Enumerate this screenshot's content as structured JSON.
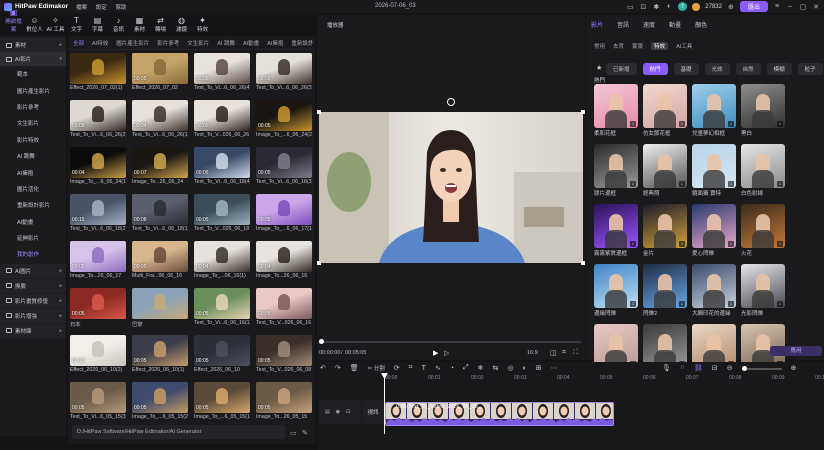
{
  "app": {
    "title": "HitPaw Edimakor",
    "menu": [
      "檔案",
      "設定",
      "幫助"
    ],
    "doc_title": "2026-07-06_03",
    "coins": "27832",
    "avatar_letter": "T",
    "export_label": "匯出"
  },
  "toolbar": [
    "開啟檔案",
    "數位人",
    "AI 工具",
    "文字",
    "字幕",
    "音訊",
    "素材",
    "轉場",
    "濾鏡",
    "特效"
  ],
  "left_nav": {
    "top": [
      "素材",
      "AI影片"
    ],
    "sub": [
      "範本",
      "圖片產生影片",
      "影片參考",
      "文生影片",
      "影片特效",
      "AI 跳舞",
      "AI擁抱",
      "圖片活化",
      "重新設計影片",
      "AI動畫",
      "延伸影片",
      "我的創作"
    ],
    "bottom": [
      "AI圖片",
      "換臉",
      "影片畫質修復",
      "影片增強",
      "素材庫"
    ]
  },
  "media_tabs": [
    "全部",
    "AI特效",
    "圖片產生影片",
    "影片參考",
    "文生影片",
    "AI 跳舞",
    "AI動畫",
    "AI擁抱",
    "重新設計"
  ],
  "media_items": [
    {
      "label": "Effect_2026_07_02(1)",
      "dur": ""
    },
    {
      "label": "Effect_2026_07_02",
      "dur": "00:05"
    },
    {
      "label": "Text_To_Vi...6_06_26(4)",
      "dur": "00:05"
    },
    {
      "label": "Text_To_Vi...6_06_26(3)",
      "dur": "00:05"
    },
    {
      "label": "Text_To_Vi...6_06_26(2)",
      "dur": "00:05"
    },
    {
      "label": "Text_To_Vi...6_06_26(1)",
      "dur": "00:04"
    },
    {
      "label": "Text_To_V...026_06_26",
      "dur": "00:05"
    },
    {
      "label": "Image_To_...6_06_24(2)",
      "dur": "00:05"
    },
    {
      "label": "Image_To_...6_06_24(1)",
      "dur": "00:04"
    },
    {
      "label": "Image_To...26_06_24",
      "dur": "00:07"
    },
    {
      "label": "Text_To_Vi...6_06_18(4)",
      "dur": "00:05"
    },
    {
      "label": "Text_To_Vi...6_06_18(3)",
      "dur": "00:05"
    },
    {
      "label": "Text_To_Vi...6_06_18(2)",
      "dur": "00:15"
    },
    {
      "label": "Text_To_Vi...6_06_18(1)",
      "dur": "00:08"
    },
    {
      "label": "Text_To_V...026_06_18",
      "dur": "00:05"
    },
    {
      "label": "Image_To_...6_06_17(1)",
      "dur": "00:05"
    },
    {
      "label": "Image_To...26_06_17",
      "dur": "00:05"
    },
    {
      "label": "Multi_Fra...06_06_16",
      "dur": "00:05"
    },
    {
      "label": "Image_To_...06_16(1)",
      "dur": "00:04"
    },
    {
      "label": "Image_To...26_06_16",
      "dur": "00:04"
    },
    {
      "label": "日本",
      "dur": "00:05"
    },
    {
      "label": "巴黎",
      "dur": ""
    },
    {
      "label": "Text_To_Vi...6_06_16(1)",
      "dur": "00:05"
    },
    {
      "label": "Text_To_V...026_06_16",
      "dur": "00:05"
    },
    {
      "label": "Effect_2026_06_10(2)",
      "dur": "00:10"
    },
    {
      "label": "Effect_2026_06_10(1)",
      "dur": "00:05"
    },
    {
      "label": "Effect_2026_06_10",
      "dur": "00:05"
    },
    {
      "label": "Text_To_V...026_06_08",
      "dur": "00:05"
    },
    {
      "label": "Text_To_Vi...6_05_15(3)",
      "dur": "00:05"
    },
    {
      "label": "Image_To_...6_05_15(2)",
      "dur": "00:05"
    },
    {
      "label": "Image_To_...6_05_15(1)",
      "dur": "00:05"
    },
    {
      "label": "Image_To...26_05_15",
      "dur": "00:05"
    }
  ],
  "path": "D:/HitPaw Software/HitPaw Edimakor/AI Generator",
  "player": {
    "title": "播放器",
    "time_current": "00:00:00",
    "time_total": "00:05:05",
    "aspect": "16:9"
  },
  "right_panel": {
    "tabs": [
      "影片",
      "音訊",
      "速度",
      "動畫",
      "顏色"
    ],
    "subtabs": [
      "常用",
      "去背",
      "蒙版",
      "特效",
      "AI工具"
    ],
    "chips": [
      "已新增",
      "熱門",
      "基礎",
      "光效",
      "自然",
      "模糊",
      "粒子"
    ],
    "section": "熱門",
    "effects": [
      "柔和花框",
      "仿女節花框",
      "兒童夢幻相框",
      "黑白",
      "膠片邊框",
      "經典照",
      "鏡面攝 寶特",
      "白色射線",
      "霧霧紫質邊框",
      "金片",
      "愛心閃爍",
      "火花",
      "邊緣閃爍",
      "閃爍2",
      "大網印花的邊緣",
      "光影閃爍",
      "",
      "",
      "",
      ""
    ],
    "apply_label": "應用"
  },
  "timeline": {
    "tools": [
      "分割"
    ],
    "ruler": [
      "00:00",
      "00:01",
      "00:02",
      "00:03",
      "00:04",
      "00:05",
      "00:06",
      "00:07",
      "00:08",
      "00:09",
      "00:10"
    ],
    "track_name": "視訊",
    "clip_label": "0:05  Text_To_Video_2026_06_26"
  }
}
